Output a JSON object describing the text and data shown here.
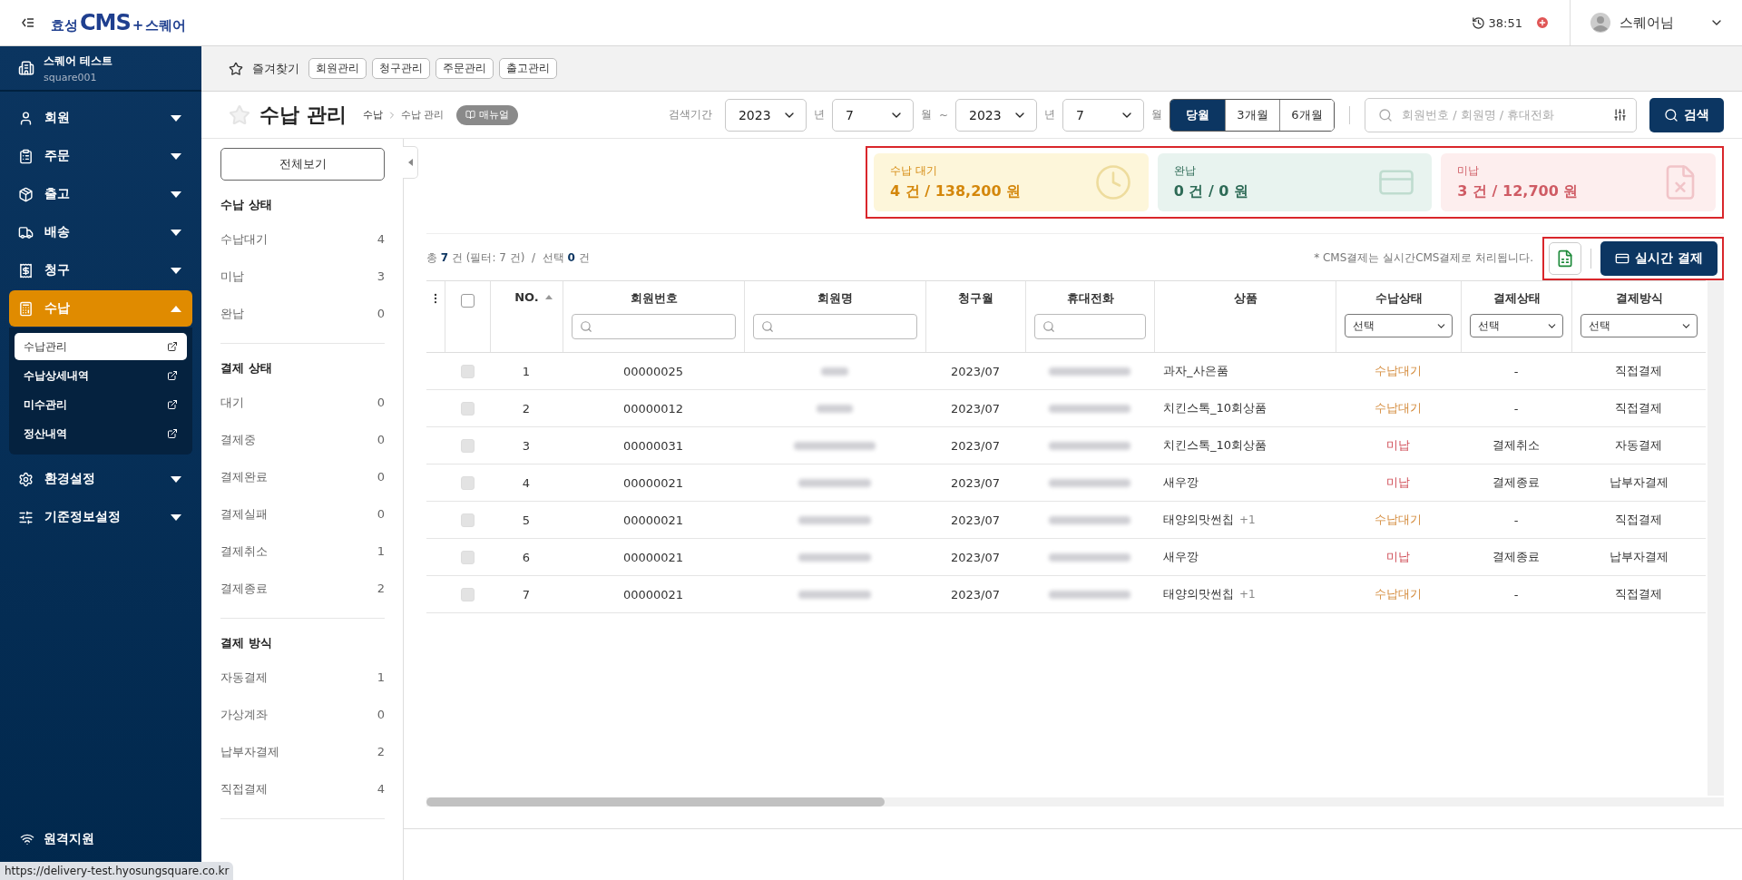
{
  "logo": {
    "prefix": "효성",
    "main": "CMS",
    "plus": "+",
    "suffix": "스퀘어"
  },
  "topbar": {
    "timer": "38:51",
    "user": "스퀘어님"
  },
  "account": {
    "name": "스퀘어 테스트",
    "id": "square001"
  },
  "nav": [
    {
      "label": "회원",
      "expanded": false,
      "selected": false
    },
    {
      "label": "주문",
      "expanded": false,
      "selected": false
    },
    {
      "label": "출고",
      "expanded": false,
      "selected": false
    },
    {
      "label": "배송",
      "expanded": false,
      "selected": false
    },
    {
      "label": "청구",
      "expanded": false,
      "selected": false
    },
    {
      "label": "수납",
      "expanded": true,
      "selected": true,
      "children": [
        {
          "label": "수납관리",
          "selected": true
        },
        {
          "label": "수납상세내역",
          "selected": false
        },
        {
          "label": "미수관리",
          "selected": false
        },
        {
          "label": "정산내역",
          "selected": false
        }
      ]
    },
    {
      "label": "환경설정",
      "expanded": false,
      "selected": false
    },
    {
      "label": "기준정보설정",
      "expanded": false,
      "selected": false
    }
  ],
  "remote_support": "원격지원",
  "favorites": {
    "label": "즐겨찾기",
    "items": [
      "회원관리",
      "청구관리",
      "주문관리",
      "출고관리"
    ]
  },
  "page": {
    "title": "수납 관리",
    "breadcrumb": [
      "수납",
      "수납 관리"
    ],
    "manual": "매뉴얼"
  },
  "search": {
    "period_label": "검색기간",
    "from": {
      "year": "2023",
      "year_unit": "년",
      "month": "7",
      "month_unit": "월"
    },
    "separator": "~",
    "to": {
      "year": "2023",
      "year_unit": "년",
      "month": "7",
      "month_unit": "월"
    },
    "ranges": [
      {
        "label": "당월",
        "selected": true
      },
      {
        "label": "3개월",
        "selected": false
      },
      {
        "label": "6개월",
        "selected": false
      }
    ],
    "placeholder": "회원번호 / 회원명 / 휴대전화",
    "button": "검색"
  },
  "filters": {
    "all_button": "전체보기",
    "groups": [
      {
        "title": "수납 상태",
        "items": [
          {
            "label": "수납대기",
            "count": "4"
          },
          {
            "label": "미납",
            "count": "3"
          },
          {
            "label": "완납",
            "count": "0"
          }
        ]
      },
      {
        "title": "결제 상태",
        "items": [
          {
            "label": "대기",
            "count": "0"
          },
          {
            "label": "결제중",
            "count": "0"
          },
          {
            "label": "결제완료",
            "count": "0"
          },
          {
            "label": "결제실패",
            "count": "0"
          },
          {
            "label": "결제취소",
            "count": "1"
          },
          {
            "label": "결제종료",
            "count": "2"
          }
        ]
      },
      {
        "title": "결제 방식",
        "items": [
          {
            "label": "자동결제",
            "count": "1"
          },
          {
            "label": "가상계좌",
            "count": "0"
          },
          {
            "label": "납부자결제",
            "count": "2"
          },
          {
            "label": "직접결제",
            "count": "4"
          }
        ]
      }
    ]
  },
  "summary_cards": [
    {
      "kind": "pending",
      "title": "수납 대기",
      "value": "4 건 / 138,200 원"
    },
    {
      "kind": "paid",
      "title": "완납",
      "value": "0 건 / 0 원"
    },
    {
      "kind": "unpaid",
      "title": "미납",
      "value": "3 건 / 12,700 원"
    }
  ],
  "result_info": "총 **7** 건 (필터: 7 건)  /  선택 **0** 건",
  "notice": "* CMS결제는 실시간CMS결제로 처리됩니다.",
  "realtime_button": "실시간 결제",
  "table": {
    "header_checked": false,
    "columns": [
      {
        "label": "NO.",
        "kind": "plain",
        "sorted": true
      },
      {
        "label": "회원번호",
        "kind": "search"
      },
      {
        "label": "회원명",
        "kind": "search"
      },
      {
        "label": "청구월",
        "kind": "plain"
      },
      {
        "label": "휴대전화",
        "kind": "search"
      },
      {
        "label": "상품",
        "kind": "plain"
      },
      {
        "label": "수납상태",
        "kind": "select",
        "value": "선택"
      },
      {
        "label": "결제상태",
        "kind": "select",
        "value": "선택"
      },
      {
        "label": "결제방식",
        "kind": "select",
        "value": "선택"
      }
    ],
    "rows": [
      {
        "checked": false,
        "disabled": true,
        "no": "1",
        "member_no": "00000025",
        "month": "2023/07",
        "product": "과자_사은품",
        "status": {
          "kind": "pending",
          "label": "수납대기"
        },
        "payment_state": "-",
        "method": "직접결제"
      },
      {
        "checked": false,
        "disabled": true,
        "no": "2",
        "member_no": "00000012",
        "month": "2023/07",
        "product": "치킨스톡_10회상품",
        "status": {
          "kind": "pending",
          "label": "수납대기"
        },
        "payment_state": "-",
        "method": "직접결제"
      },
      {
        "checked": false,
        "disabled": true,
        "no": "3",
        "member_no": "00000031",
        "month": "2023/07",
        "product": "치킨스톡_10회상품",
        "status": {
          "kind": "unpaid",
          "label": "미납"
        },
        "payment_state": "결제취소",
        "method": "자동결제"
      },
      {
        "checked": false,
        "disabled": true,
        "no": "4",
        "member_no": "00000021",
        "month": "2023/07",
        "product": "새우깡",
        "status": {
          "kind": "unpaid",
          "label": "미납"
        },
        "payment_state": "결제종료",
        "method": "납부자결제"
      },
      {
        "checked": false,
        "disabled": true,
        "no": "5",
        "member_no": "00000021",
        "month": "2023/07",
        "product": "태양의맛썬칩",
        "product_extra": "+1",
        "status": {
          "kind": "pending",
          "label": "수납대기"
        },
        "payment_state": "-",
        "method": "직접결제"
      },
      {
        "checked": false,
        "disabled": true,
        "no": "6",
        "member_no": "00000021",
        "month": "2023/07",
        "product": "새우깡",
        "status": {
          "kind": "unpaid",
          "label": "미납"
        },
        "payment_state": "결제종료",
        "method": "납부자결제"
      },
      {
        "checked": false,
        "disabled": true,
        "no": "7",
        "member_no": "00000021",
        "month": "2023/07",
        "product": "태양의맛썬칩",
        "product_extra": "+1",
        "status": {
          "kind": "pending",
          "label": "수납대기"
        },
        "payment_state": "-",
        "method": "직접결제"
      }
    ]
  },
  "status_url": "https://delivery-test.hyosungsquare.co.kr"
}
